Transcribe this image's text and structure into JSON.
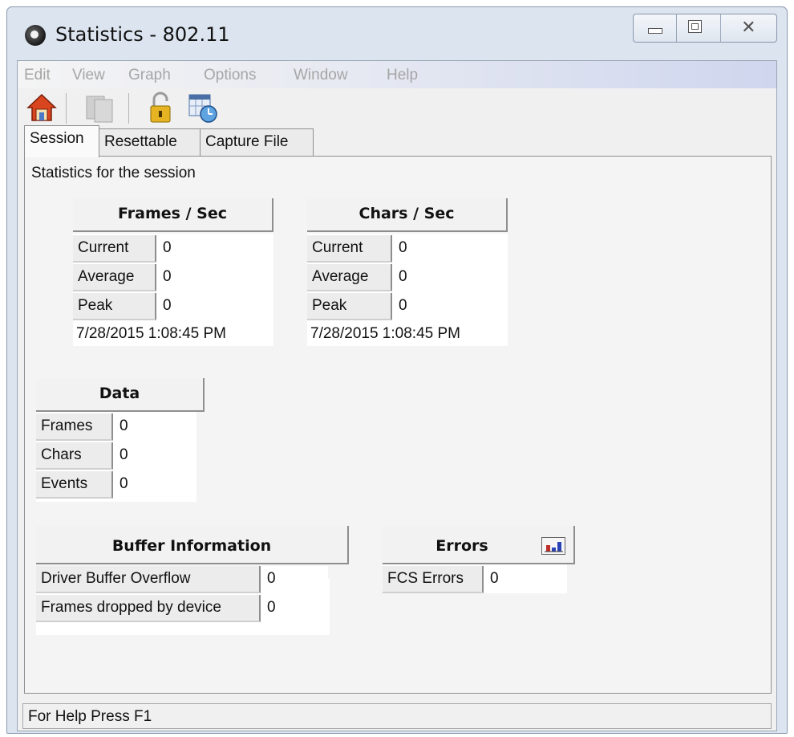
{
  "window": {
    "title": "Statistics - 802.11"
  },
  "menu": [
    "Edit",
    "View",
    "Graph",
    "Options",
    "Window",
    "Help"
  ],
  "toolbar": {
    "icons": [
      "home-icon",
      "disabled-copy-icon",
      "unlock-icon",
      "calendar-clock-icon"
    ]
  },
  "tabs": [
    "Session",
    "Resettable",
    "Capture File"
  ],
  "active_tab": "Session",
  "panel": {
    "description": "Statistics for the session",
    "frames_per_sec": {
      "title": "Frames / Sec",
      "rows": [
        {
          "label": "Current",
          "value": "0"
        },
        {
          "label": "Average",
          "value": "0"
        },
        {
          "label": "Peak",
          "value": "0"
        }
      ],
      "timestamp": "7/28/2015 1:08:45 PM"
    },
    "chars_per_sec": {
      "title": "Chars / Sec",
      "rows": [
        {
          "label": "Current",
          "value": "0"
        },
        {
          "label": "Average",
          "value": "0"
        },
        {
          "label": "Peak",
          "value": "0"
        }
      ],
      "timestamp": "7/28/2015 1:08:45 PM"
    },
    "data": {
      "title": "Data",
      "rows": [
        {
          "label": "Frames",
          "value": "0"
        },
        {
          "label": "Chars",
          "value": "0"
        },
        {
          "label": "Events",
          "value": "0"
        }
      ]
    },
    "buffer": {
      "title": "Buffer Information",
      "rows": [
        {
          "label": "Driver Buffer Overflow",
          "value": "0"
        },
        {
          "label": "Frames dropped by device",
          "value": "0"
        }
      ]
    },
    "errors": {
      "title": "Errors",
      "chart_icon": "bar-chart-icon",
      "rows": [
        {
          "label": "FCS Errors",
          "value": "0"
        }
      ]
    }
  },
  "status_bar": {
    "text": "For Help Press F1"
  },
  "colors": {
    "menu_disabled": "#a6a6a6",
    "window_frame": "#dbe4ef",
    "panel_bg": "#f4f4f4"
  }
}
